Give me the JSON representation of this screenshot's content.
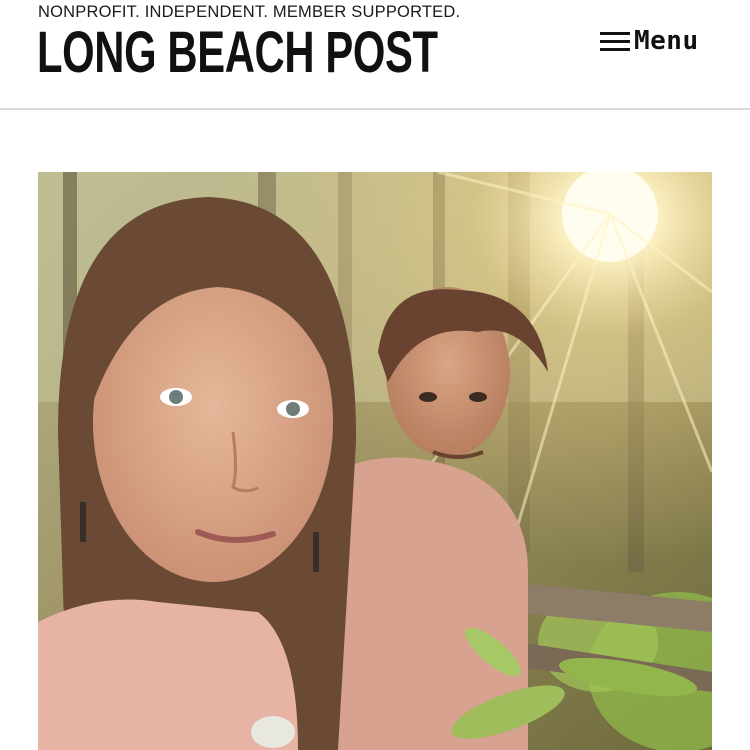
{
  "site": {
    "tagline": "NONPROFIT. INDEPENDENT. MEMBER SUPPORTED.",
    "name": "LONG BEACH POST"
  },
  "nav": {
    "menu_label": "Menu",
    "menu_icon": "hamburger-icon"
  },
  "hero": {
    "alt": "Selfie of a woman and a young man in a sunlit forest"
  }
}
